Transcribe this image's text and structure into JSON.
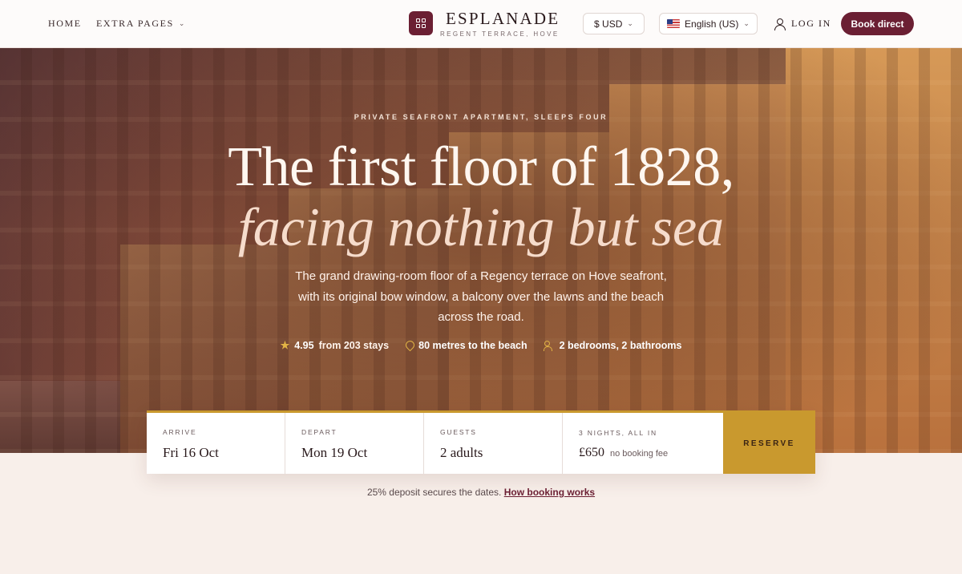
{
  "nav": {
    "home": "HOME",
    "extra_pages": "EXTRA PAGES"
  },
  "brand": {
    "name": "ESPLANADE",
    "subtitle": "REGENT TERRACE, HOVE"
  },
  "header": {
    "currency": "$  USD",
    "language": "English (US)",
    "login": "LOG IN",
    "book_direct": "Book direct"
  },
  "hero": {
    "eyebrow": "PRIVATE SEAFRONT APARTMENT, SLEEPS FOUR",
    "headline": "The first floor of 1828,",
    "headline_italic": "facing nothing but sea",
    "lede": "The grand drawing-room floor of a Regency terrace on Hove seafront, with its original bow window, a balcony over the lawns and the beach across the road.",
    "rating": "4.95",
    "rating_note": "from 203 stays",
    "distance": "80 metres to the beach",
    "rooms": "2 bedrooms, 2 bathrooms"
  },
  "booking": {
    "arrive_label": "ARRIVE",
    "arrive_value": "Fri 16 Oct",
    "depart_label": "DEPART",
    "depart_value": "Mon 19 Oct",
    "guests_label": "GUESTS",
    "guests_value": "2 adults",
    "total_label": "3 NIGHTS, ALL IN",
    "total_value": "£650",
    "total_note": "no booking fee",
    "reserve": "RESERVE"
  },
  "deposit": {
    "text": "25% deposit secures the dates.",
    "link": "How booking works"
  },
  "colors": {
    "accent": "#6b1f33",
    "gold": "#c9992e",
    "background": "#f8efea"
  }
}
